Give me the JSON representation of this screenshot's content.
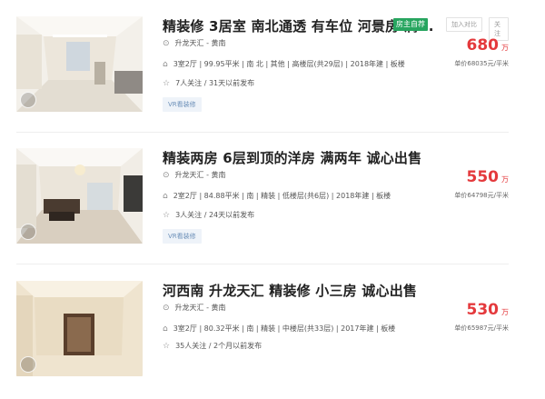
{
  "listings": [
    {
      "title": "精装修 3居室 南北通透 有车位 河景房 满...",
      "owner_tag": "房主自荐",
      "btn_compare": "加入对比",
      "btn_follow": "关注",
      "community": "升龙天汇 - 黄南",
      "details": "3室2厅 | 99.95平米 | 南 北 | 其他 | 高楼层(共29层) | 2018年建 | 板楼",
      "follow_info": "7人关注 / 31天以前发布",
      "price": "680",
      "price_unit": "万",
      "unit_price": "单价68035元/平米",
      "vr_tag": "VR看装修"
    },
    {
      "title": "精装两房 6层到顶的洋房 满两年 诚心出售",
      "community": "升龙天汇 - 黄南",
      "details": "2室2厅 | 84.88平米 | 南 | 精装 | 低楼层(共6层) | 2018年建 | 板楼",
      "follow_info": "3人关注 / 24天以前发布",
      "price": "550",
      "price_unit": "万",
      "unit_price": "单价64798元/平米",
      "vr_tag": "VR看装修"
    },
    {
      "title": "河西南 升龙天汇 精装修 小三房 诚心出售",
      "community": "升龙天汇 - 黄南",
      "details": "3室2厅 | 80.32平米 | 南 | 精装 | 中楼层(共33层) | 2017年建 | 板楼",
      "follow_info": "35人关注 / 2个月以前发布",
      "price": "530",
      "price_unit": "万",
      "unit_price": "单价65987元/平米"
    }
  ],
  "icons": {
    "location": "location-pin-icon",
    "house": "house-icon",
    "star": "star-icon"
  },
  "colors": {
    "price_red": "#e4393c",
    "owner_green": "#27a55f",
    "vr_blue": "#6b8fb8"
  }
}
